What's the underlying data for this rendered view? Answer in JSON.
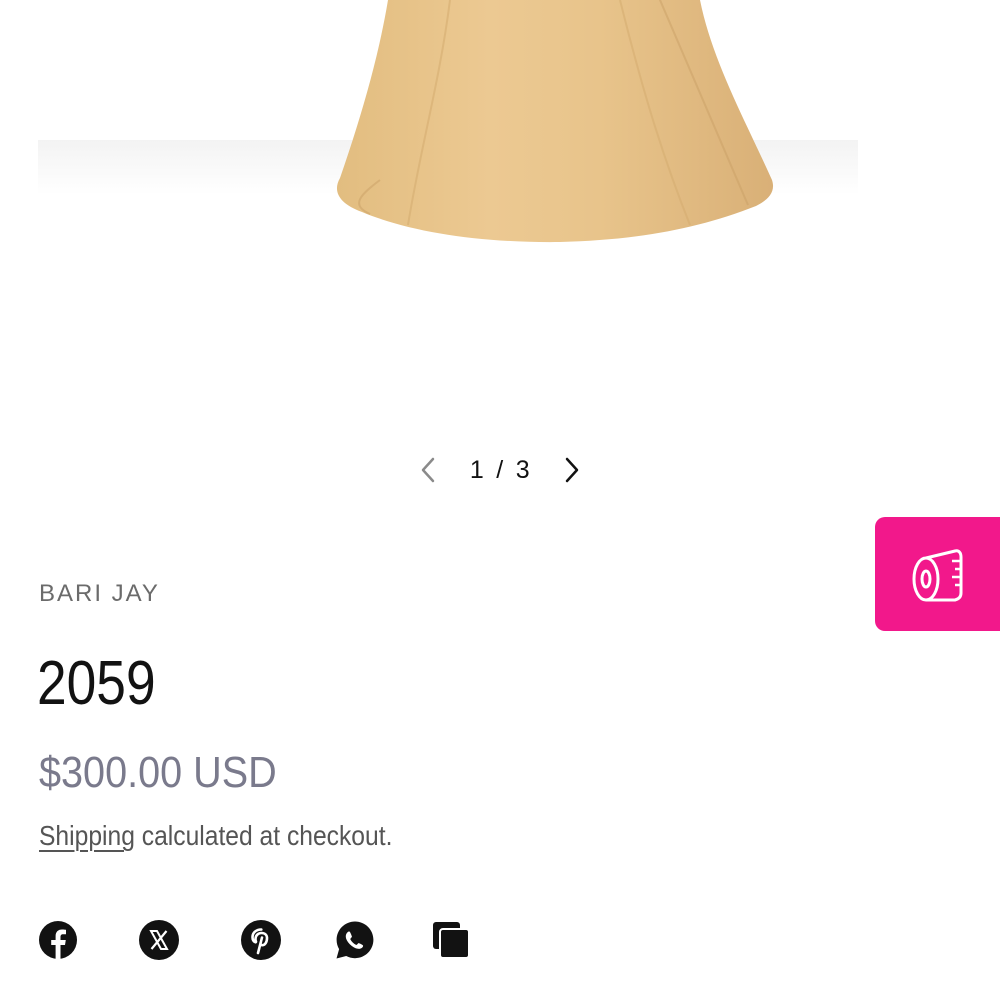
{
  "gallery": {
    "current_slide": "1",
    "separator": "/",
    "total_slides": "3",
    "prev_icon": "chevron-left-icon",
    "next_icon": "chevron-right-icon",
    "dress_color": "#e6c48a"
  },
  "product": {
    "vendor": "BARI JAY",
    "title": "2059",
    "price": "$300.00 USD",
    "shipping_link": "Shipping",
    "shipping_rest": " calculated at checkout."
  },
  "share": {
    "icons": [
      "facebook-icon",
      "x-icon",
      "pinterest-icon",
      "whatsapp-icon",
      "copy-link-icon"
    ]
  },
  "size_guide": {
    "icon": "measuring-tape-icon",
    "color": "#f2188b"
  }
}
